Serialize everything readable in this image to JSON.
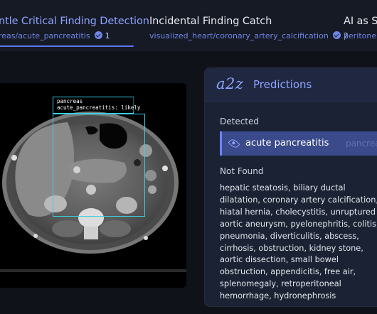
{
  "tabs": [
    {
      "title": "ntle Critical Finding Detection",
      "subtitle": "reas/acute_pancreatitis",
      "count": "1",
      "active": true
    },
    {
      "title": "Incidental Finding Catch",
      "subtitle": "visualized_heart/coronary_artery_calcification",
      "count": "2",
      "active": false
    },
    {
      "title": "AI as Se",
      "subtitle": "peritoneu",
      "count": "",
      "active": false
    }
  ],
  "scan": {
    "annotation_lines": [
      "pancreas",
      "acute_pancreatitis: likely"
    ]
  },
  "predictions": {
    "logo": "a2z",
    "title": "Predictions",
    "detected_label": "Detected",
    "detected_item": "acute pancreatitis",
    "detected_ghost": "pancrea",
    "not_found_label": "Not Found",
    "not_found_text": "hepatic steatosis, biliary ductal dilatation, coronary artery calcification, hiatal hernia, cholecystitis, unruptured aortic aneurysm, pyelonephritis, colitis, pneumonia, diverticulitis, abscess, cirrhosis, obstruction, kidney stone, aortic dissection, small bowel obstruction, appendicitis, free air, splenomegaly, retroperitoneal hemorrhage, hydronephrosis"
  },
  "colors": {
    "accent": "#6f86e6",
    "bbox": "#38cfe0",
    "background": "#0f1219",
    "panel": "#1b2233"
  }
}
